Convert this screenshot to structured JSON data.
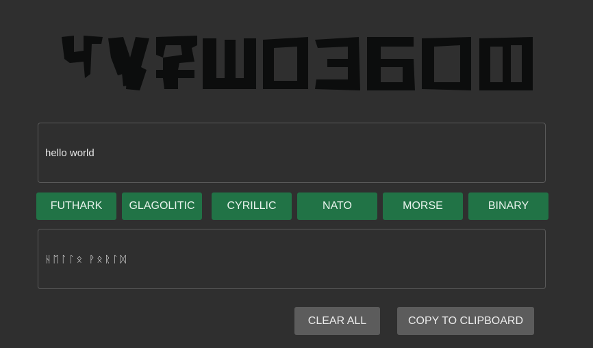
{
  "header": {
    "logo_name": "runic-title-logo",
    "logo_color": "#0c0d0d"
  },
  "input": {
    "value": "hello world"
  },
  "scripts": {
    "buttons": [
      "FUTHARK",
      "GLAGOLITIC",
      "CYRILLIC",
      "NATO",
      "MORSE",
      "BINARY"
    ],
    "accent": "#217346"
  },
  "output": {
    "value": "ᚺᛖᛚᛚᛟ ᚹᛟᚱᛚᛞ"
  },
  "actions": {
    "clear_label": "CLEAR ALL",
    "copy_label": "COPY TO CLIPBOARD"
  }
}
